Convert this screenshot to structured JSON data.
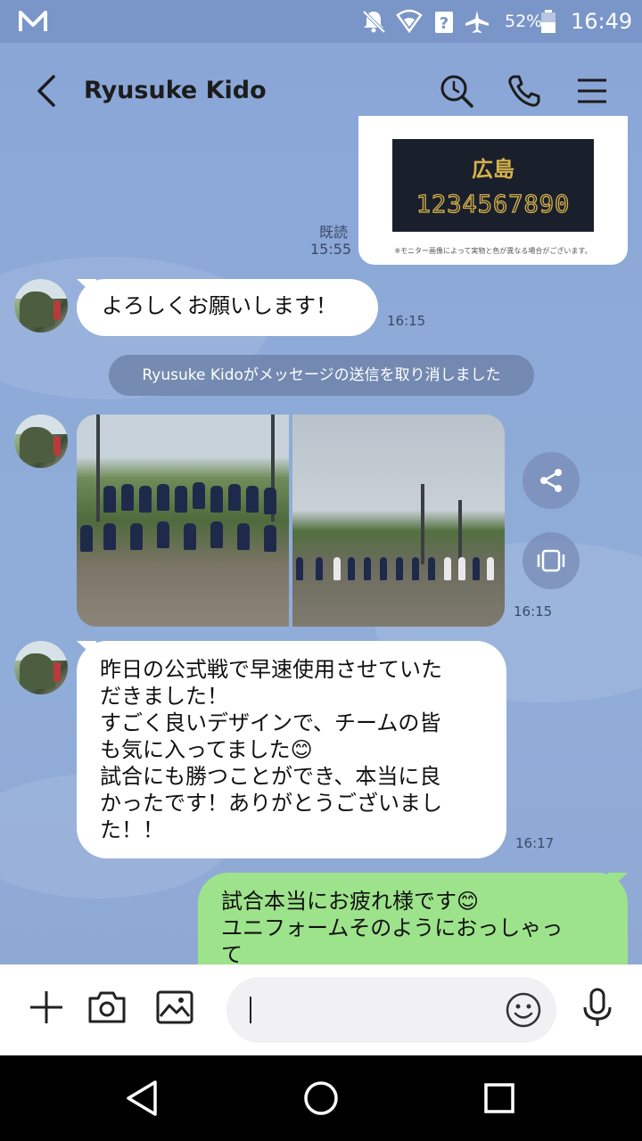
{
  "status_bar": {
    "battery": "52%",
    "time": "16:49"
  },
  "header": {
    "contact_name": "Ryusuke Kido"
  },
  "messages": {
    "sent_card": {
      "kanji": "広島",
      "numbers": "1234567890",
      "note": "※モニター画像によって実物と色が異なる場合がございます。",
      "read": "既読",
      "time": "15:55"
    },
    "msg1": {
      "text": "よろしくお願いします！",
      "time": "16:15"
    },
    "system": "Ryusuke Kidoがメッセージの送信を取り消しました",
    "photos": {
      "time": "16:15"
    },
    "msg2": {
      "text": "昨日の公式戦で早速使用させていた\nだきました！\nすごく良いデザインで、チームの皆\nも気に入ってました😊\n試合にも勝つことができ、本当に良\nかったです！ありがとうございまし\nた！！",
      "time": "16:17"
    },
    "msg3": {
      "text": "試合本当にお疲れ様です😊\nユニフォームそのようにおっしゃっ\nて"
    }
  },
  "input": {
    "value": ""
  },
  "icons": {
    "back": "chevron-left-icon",
    "search": "search-icon",
    "call": "phone-icon",
    "menu": "hamburger-menu-icon",
    "share": "share-icon",
    "album": "album-icon",
    "add": "plus-icon",
    "camera": "camera-icon",
    "image": "image-icon",
    "emoji": "smiley-icon",
    "mic": "microphone-icon"
  },
  "colors": {
    "chat_bg": "#8aa6d6",
    "sent_bubble": "#9de38b",
    "received_bubble": "#ffffff"
  }
}
